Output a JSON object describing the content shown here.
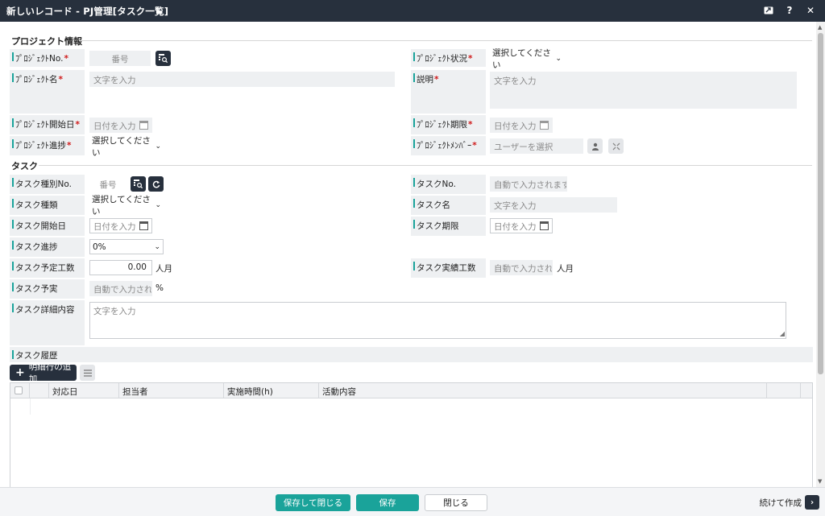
{
  "window": {
    "title": "新しいレコード - PJ管理[タスク一覧]"
  },
  "project": {
    "section_title": "プロジェクト情報",
    "no_label": "ﾌﾟﾛｼﾞｪｸﾄNo.",
    "no_placeholder": "番号",
    "status_label": "ﾌﾟﾛｼﾞｪｸﾄ状況",
    "status_value": "選択してください",
    "name_label": "ﾌﾟﾛｼﾞｪｸﾄ名",
    "name_placeholder": "文字を入力",
    "desc_label": "説明",
    "desc_placeholder": "文字を入力",
    "start_label": "ﾌﾟﾛｼﾞｪｸﾄ開始日",
    "start_placeholder": "日付を入力",
    "deadline_label": "ﾌﾟﾛｼﾞｪｸﾄ期限",
    "deadline_placeholder": "日付を入力",
    "progress_label": "ﾌﾟﾛｼﾞｪｸﾄ進捗",
    "progress_value": "選択してください",
    "member_label": "ﾌﾟﾛｼﾞｪｸﾄﾒﾝﾊﾞｰ",
    "member_placeholder": "ユーザーを選択"
  },
  "task": {
    "section_title": "タスク",
    "type_no_label": "タスク種別No.",
    "type_no_placeholder": "番号",
    "no_label": "タスクNo.",
    "no_value": "自動で入力されます。",
    "type_label": "タスク種類",
    "type_value": "選択してください",
    "name_label": "タスク名",
    "name_placeholder": "文字を入力",
    "start_label": "タスク開始日",
    "start_placeholder": "日付を入力",
    "deadline_label": "タスク期限",
    "deadline_placeholder": "日付を入力",
    "progress_label": "タスク進捗",
    "progress_value": "0%",
    "planned_label": "タスク予定工数",
    "planned_value": "0.00",
    "planned_unit": "人月",
    "actual_label": "タスク実績工数",
    "actual_value": "自動で入力され",
    "actual_unit": "人月",
    "ratio_label": "タスク予実",
    "ratio_value": "自動で入力され",
    "ratio_unit": "%",
    "detail_label": "タスク詳細内容",
    "detail_placeholder": "文字を入力",
    "history_label": "タスク履歴"
  },
  "history": {
    "add_row_label": "明細行の追加",
    "columns": [
      "対応日",
      "担当者",
      "実施時間(h)",
      "活動内容"
    ]
  },
  "footer": {
    "save_close": "保存して閉じる",
    "save": "保存",
    "close": "閉じる",
    "continue": "続けて作成"
  },
  "colors": {
    "accent": "#1aa39a",
    "dark": "#27303d",
    "required": "#d01b1b"
  },
  "icons": [
    "expand-icon",
    "help-icon",
    "close-icon",
    "lookup-icon",
    "refresh-icon",
    "calendar-icon",
    "user-icon",
    "clear-icon",
    "menu-icon",
    "chevron-right-icon"
  ]
}
